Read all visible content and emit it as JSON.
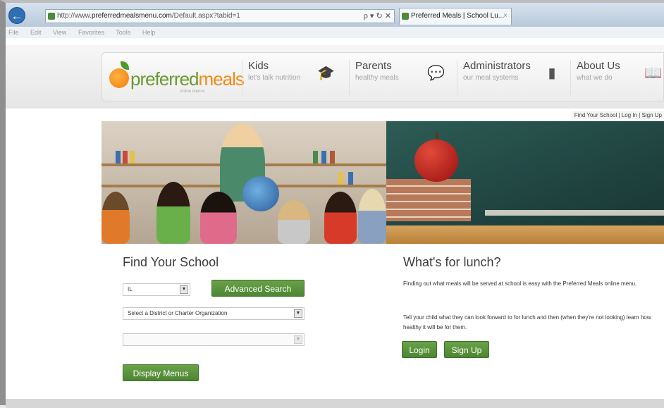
{
  "browser": {
    "address_prefix": "http://www.",
    "address_domain": "preferredmealsmenu.com",
    "address_rest": "/Default.aspx?tabid=1",
    "address_controls": "ρ ▾ ↻ ✕",
    "tab_title": "Preferred Meals | School Lu...",
    "tab_close": "×",
    "back_icon": "←",
    "menu": [
      "File",
      "Edit",
      "View",
      "Favorites",
      "Tools",
      "Help"
    ]
  },
  "logo": {
    "text_a": "preferred",
    "text_b": "meals",
    "sub": "online menus"
  },
  "nav": [
    {
      "title": "Kids",
      "subtitle": "let's talk nutrition",
      "icon": "graduation-cap-icon",
      "glyph": "🎓"
    },
    {
      "title": "Parents",
      "subtitle": "healthy meals",
      "icon": "chat-bubbles-icon",
      "glyph": "💬"
    },
    {
      "title": "Administrators",
      "subtitle": "our meal systems",
      "icon": "book-icon",
      "glyph": "▮"
    },
    {
      "title": "About Us",
      "subtitle": "what we do",
      "icon": "open-book-icon",
      "glyph": "📖"
    }
  ],
  "toplinks": "Find Your School | Log In | Sign Up",
  "find_school": {
    "heading": "Find Your School",
    "state_value": "IL",
    "advanced_search": "Advanced Search",
    "district_placeholder": "Select a District or Charter Organization",
    "school_value": "",
    "display_menus": "Display Menus"
  },
  "lunch": {
    "heading": "What's for lunch?",
    "para1": "Finding out what meals will be served at school is easy with the Preferred Meals online menu.",
    "para2": "Tell your child what they can look forward to for lunch and then (when they're not looking) learn how healthy it will be for them.",
    "login": "Login",
    "signup": "Sign Up"
  }
}
